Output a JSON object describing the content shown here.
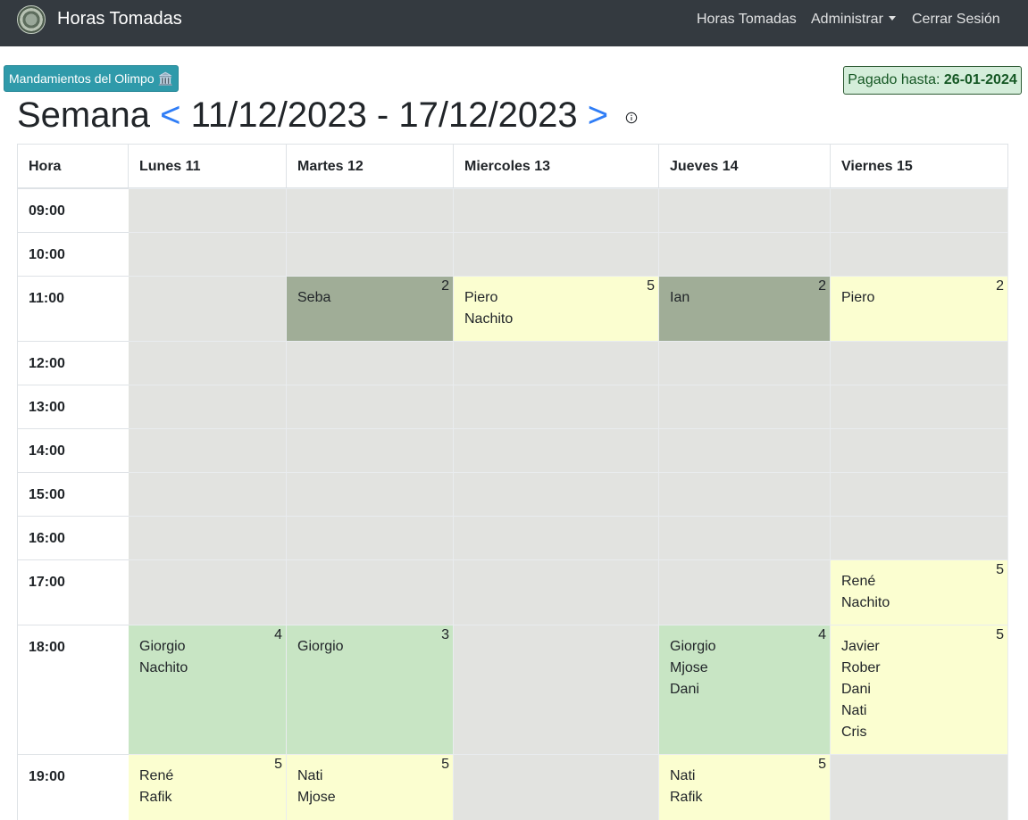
{
  "navbar": {
    "brand": "Horas Tomadas",
    "links": [
      "Horas Tomadas",
      "Administrar",
      "Cerrar Sesión"
    ]
  },
  "olimpo_button": {
    "label": "Mandamientos del Olimpo",
    "icon": "🏛️"
  },
  "pagado": {
    "label": "Pagado hasta:",
    "date": "26-01-2024"
  },
  "week": {
    "label": "Semana",
    "prev": "<",
    "range": "11/12/2023 - 17/12/2023",
    "next": ">"
  },
  "table": {
    "hour_header": "Hora",
    "days": [
      "Lunes 11",
      "Martes 12",
      "Miercoles 13",
      "Jueves 14",
      "Viernes 15"
    ],
    "hours": [
      "09:00",
      "10:00",
      "11:00",
      "12:00",
      "13:00",
      "14:00",
      "15:00",
      "16:00",
      "17:00",
      "18:00",
      "19:00"
    ],
    "rows": [
      [
        {
          "t": "empty"
        },
        {
          "t": "empty"
        },
        {
          "t": "empty"
        },
        {
          "t": "empty"
        },
        {
          "t": "empty"
        }
      ],
      [
        {
          "t": "empty"
        },
        {
          "t": "empty"
        },
        {
          "t": "empty"
        },
        {
          "t": "empty"
        },
        {
          "t": "empty"
        }
      ],
      [
        {
          "t": "empty"
        },
        {
          "t": "dark",
          "count": "2",
          "names": [
            "Seba"
          ]
        },
        {
          "t": "yellow",
          "count": "5",
          "names": [
            "Piero",
            "Nachito"
          ]
        },
        {
          "t": "dark",
          "count": "2",
          "names": [
            "Ian"
          ]
        },
        {
          "t": "yellow",
          "count": "2",
          "names": [
            "Piero"
          ]
        }
      ],
      [
        {
          "t": "empty"
        },
        {
          "t": "empty"
        },
        {
          "t": "empty"
        },
        {
          "t": "empty"
        },
        {
          "t": "empty"
        }
      ],
      [
        {
          "t": "empty"
        },
        {
          "t": "empty"
        },
        {
          "t": "empty"
        },
        {
          "t": "empty"
        },
        {
          "t": "empty"
        }
      ],
      [
        {
          "t": "empty"
        },
        {
          "t": "empty"
        },
        {
          "t": "empty"
        },
        {
          "t": "empty"
        },
        {
          "t": "empty"
        }
      ],
      [
        {
          "t": "empty"
        },
        {
          "t": "empty"
        },
        {
          "t": "empty"
        },
        {
          "t": "empty"
        },
        {
          "t": "empty"
        }
      ],
      [
        {
          "t": "empty"
        },
        {
          "t": "empty"
        },
        {
          "t": "empty"
        },
        {
          "t": "empty"
        },
        {
          "t": "empty"
        }
      ],
      [
        {
          "t": "empty"
        },
        {
          "t": "empty"
        },
        {
          "t": "empty"
        },
        {
          "t": "empty"
        },
        {
          "t": "yellow",
          "count": "5",
          "names": [
            "René",
            "Nachito"
          ]
        }
      ],
      [
        {
          "t": "green",
          "count": "4",
          "names": [
            "Giorgio",
            "Nachito"
          ]
        },
        {
          "t": "green",
          "count": "3",
          "names": [
            "Giorgio"
          ]
        },
        {
          "t": "empty"
        },
        {
          "t": "green",
          "count": "4",
          "names": [
            "Giorgio",
            "Mjose",
            "Dani"
          ]
        },
        {
          "t": "yellow",
          "count": "5",
          "names": [
            "Javier",
            "Rober",
            "Dani",
            "Nati",
            "Cris"
          ]
        }
      ],
      [
        {
          "t": "yellow",
          "count": "5",
          "names": [
            "René",
            "Rafik"
          ]
        },
        {
          "t": "yellow",
          "count": "5",
          "names": [
            "Nati",
            "Mjose"
          ]
        },
        {
          "t": "empty"
        },
        {
          "t": "yellow",
          "count": "5",
          "names": [
            "Nati",
            "Rafik"
          ]
        },
        {
          "t": "empty"
        }
      ]
    ]
  }
}
